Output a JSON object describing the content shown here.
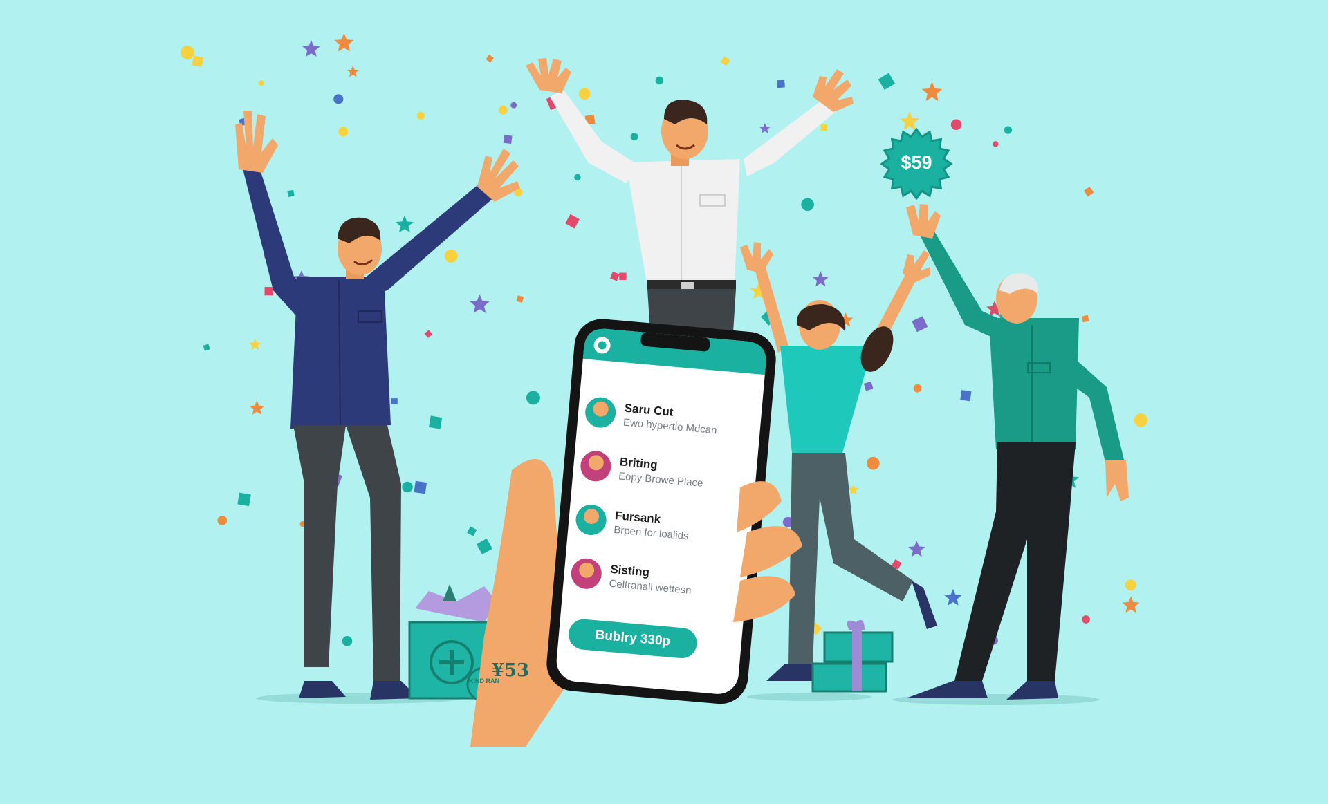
{
  "scene": {
    "background_color": "#b1f1ef",
    "accent_teal": "#1bb1a0",
    "price_badge": {
      "label": "$59",
      "icon": "starburst-badge"
    },
    "cash_box_label": "¥53",
    "cash_box_stamp": "KIND RAN"
  },
  "phone": {
    "header_icon": "app-logo-icon",
    "contacts": [
      {
        "name": "Saru Cut",
        "subtitle": "Ewo hypertio Mdcan"
      },
      {
        "name": "Briting",
        "subtitle": "Eopy Browe Place"
      },
      {
        "name": "Fursank",
        "subtitle": "Brpen for loalids"
      },
      {
        "name": "Sisting",
        "subtitle": "Celtranall wettesn"
      }
    ],
    "buy_button_label": "Bublry 330p"
  }
}
